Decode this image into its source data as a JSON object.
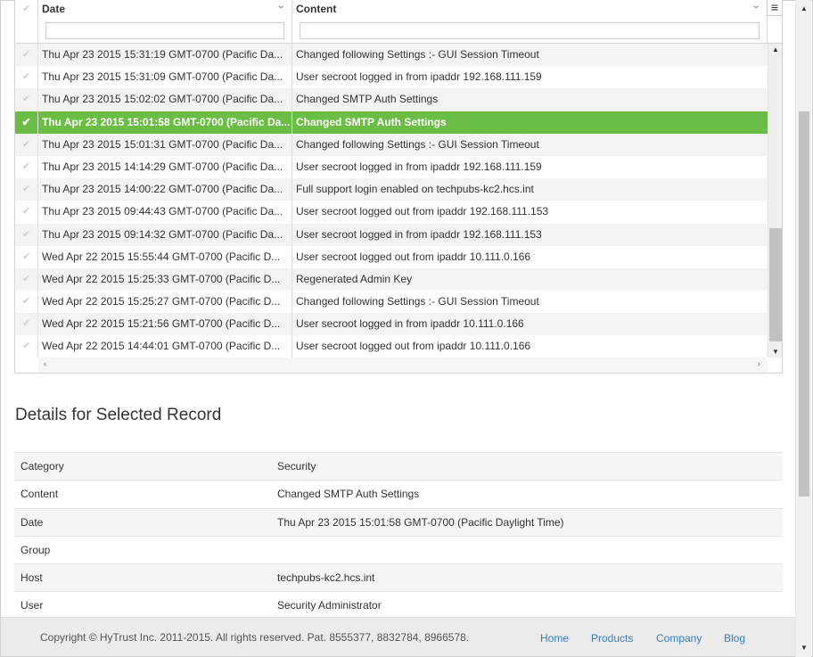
{
  "grid": {
    "columns": {
      "date": "Date",
      "content": "Content"
    },
    "filters": {
      "date": "",
      "content": ""
    },
    "rows": [
      {
        "date": "Thu Apr 23 2015 15:31:19 GMT-0700 (Pacific Da...",
        "content": "Changed following Settings :- GUI Session Timeout",
        "selected": false
      },
      {
        "date": "Thu Apr 23 2015 15:31:09 GMT-0700 (Pacific Da...",
        "content": "User secroot logged in from ipaddr 192.168.111.159",
        "selected": false
      },
      {
        "date": "Thu Apr 23 2015 15:02:02 GMT-0700 (Pacific Da...",
        "content": "Changed SMTP Auth Settings",
        "selected": false
      },
      {
        "date": "Thu Apr 23 2015 15:01:58 GMT-0700 (Pacific Da...",
        "content": "Changed SMTP Auth Settings",
        "selected": true
      },
      {
        "date": "Thu Apr 23 2015 15:01:31 GMT-0700 (Pacific Da...",
        "content": "Changed following Settings :- GUI Session Timeout",
        "selected": false
      },
      {
        "date": "Thu Apr 23 2015 14:14:29 GMT-0700 (Pacific Da...",
        "content": "User secroot logged in from ipaddr 192.168.111.159",
        "selected": false
      },
      {
        "date": "Thu Apr 23 2015 14:00:22 GMT-0700 (Pacific Da...",
        "content": "Full support login enabled on techpubs-kc2.hcs.int",
        "selected": false
      },
      {
        "date": "Thu Apr 23 2015 09:44:43 GMT-0700 (Pacific Da...",
        "content": "User secroot logged out from ipaddr 192.168.111.153",
        "selected": false
      },
      {
        "date": "Thu Apr 23 2015 09:14:32 GMT-0700 (Pacific Da...",
        "content": "User secroot logged in from ipaddr 192.168.111.153",
        "selected": false
      },
      {
        "date": "Wed Apr 22 2015 15:55:44 GMT-0700 (Pacific D...",
        "content": "User secroot logged out from ipaddr 10.111.0.166",
        "selected": false
      },
      {
        "date": "Wed Apr 22 2015 15:25:33 GMT-0700 (Pacific D...",
        "content": "Regenerated Admin Key",
        "selected": false
      },
      {
        "date": "Wed Apr 22 2015 15:25:27 GMT-0700 (Pacific D...",
        "content": "Changed following Settings :- GUI Session Timeout",
        "selected": false
      },
      {
        "date": "Wed Apr 22 2015 15:21:56 GMT-0700 (Pacific D...",
        "content": "User secroot logged in from ipaddr 10.111.0.166",
        "selected": false
      },
      {
        "date": "Wed Apr 22 2015 14:44:01 GMT-0700 (Pacific D...",
        "content": "User secroot logged out from ipaddr 10.111.0.166",
        "selected": false
      }
    ]
  },
  "details": {
    "title": "Details for Selected Record",
    "fields": [
      {
        "key": "Category",
        "value": "Security"
      },
      {
        "key": "Content",
        "value": "Changed SMTP Auth Settings"
      },
      {
        "key": "Date",
        "value": "Thu Apr 23 2015 15:01:58 GMT-0700 (Pacific Daylight Time)"
      },
      {
        "key": "Group",
        "value": ""
      },
      {
        "key": "Host",
        "value": "techpubs-kc2.hcs.int"
      },
      {
        "key": "User",
        "value": "Security Administrator"
      }
    ]
  },
  "footer": {
    "copyright": "Copyright © HyTrust Inc. 2011-2015. All rights reserved. Pat. 8555377, 8832784, 8966578.",
    "links": [
      "Home",
      "Products",
      "Company",
      "Blog"
    ]
  },
  "colors": {
    "selected_row": "#6bbd45",
    "link": "#3a7cc2",
    "footer_bg": "#ebebeb"
  },
  "icons": {
    "row_check": "check-icon",
    "sort": "chevron-down-icon",
    "grid_menu": "menu-icon"
  }
}
